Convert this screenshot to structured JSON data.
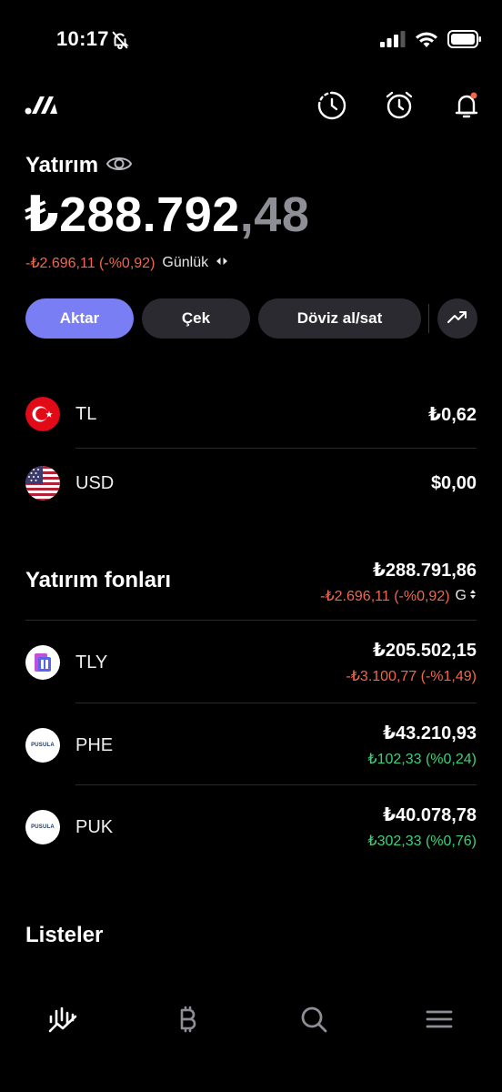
{
  "status_bar": {
    "time": "10:17",
    "icons": [
      "bell-slash-icon",
      "signal-icon",
      "wifi-icon",
      "battery-icon"
    ]
  },
  "header": {
    "icons": [
      "app-logo",
      "history-icon",
      "alarm-icon",
      "notification-bell-icon"
    ]
  },
  "account": {
    "title": "Yatırım",
    "balance_main": "₺288.792",
    "balance_decimal": ",48",
    "daily_change": "-₺2.696,11 (-%0,92)",
    "period": "Günlük"
  },
  "actions": {
    "transfer": "Aktar",
    "withdraw": "Çek",
    "fx": "Döviz al/sat"
  },
  "cash": [
    {
      "code": "TL",
      "value": "₺0,62",
      "icon": "turkey-flag-icon"
    },
    {
      "code": "USD",
      "value": "$0,00",
      "icon": "us-flag-icon"
    }
  ],
  "funds": {
    "title": "Yatırım fonları",
    "total": "₺288.791,86",
    "total_change": "-₺2.696,11 (-%0,92)",
    "sort_label": "G",
    "items": [
      {
        "code": "TLY",
        "value": "₺205.502,15",
        "change": "-₺3.100,77 (-%1,49)",
        "direction": "negative",
        "logo_text": ""
      },
      {
        "code": "PHE",
        "value": "₺43.210,93",
        "change": "₺102,33 (%0,24)",
        "direction": "positive",
        "logo_text": "PUSULA"
      },
      {
        "code": "PUK",
        "value": "₺40.078,78",
        "change": "₺302,33 (%0,76)",
        "direction": "positive",
        "logo_text": "PUSULA"
      }
    ]
  },
  "lists": {
    "title": "Listeler"
  },
  "bottom_nav": [
    "portfolio-chart-icon",
    "bitcoin-icon",
    "search-icon",
    "menu-icon"
  ],
  "colors": {
    "background": "#000000",
    "accent": "#7a7ef5",
    "button": "#2a2a30",
    "negative": "#f2664c",
    "positive": "#3fd07a",
    "muted_decimal": "#8e8e96"
  }
}
